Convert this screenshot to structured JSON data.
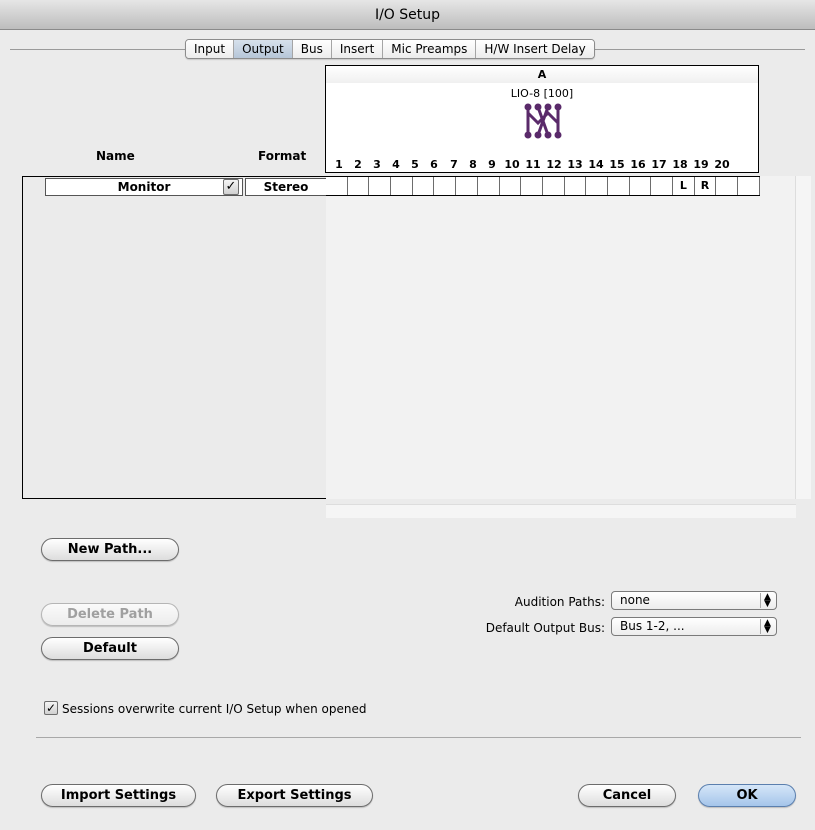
{
  "window": {
    "title": "I/O Setup"
  },
  "tabs": [
    "Input",
    "Output",
    "Bus",
    "Insert",
    "Mic Preamps",
    "H/W Insert Delay"
  ],
  "active_tab": "Output",
  "matrix": {
    "section": "A",
    "device": "LIO-8 [100]",
    "device_icon": "lio-device-icon",
    "channels": [
      "1",
      "2",
      "3",
      "4",
      "5",
      "6",
      "7",
      "8",
      "9",
      "10",
      "11",
      "12",
      "13",
      "14",
      "15",
      "16",
      "17",
      "18",
      "19",
      "20"
    ]
  },
  "columns": {
    "name": "Name",
    "format": "Format"
  },
  "paths": [
    {
      "name": "Monitor",
      "active": true,
      "check_glyph": "✓",
      "format": "Stereo",
      "assignments": [
        "",
        "",
        "",
        "",
        "",
        "",
        "",
        "",
        "",
        "",
        "",
        "",
        "",
        "",
        "",
        "",
        "L",
        "R",
        "",
        ""
      ]
    }
  ],
  "buttons": {
    "new_path": "New Path...",
    "delete_path": "Delete Path",
    "default": "Default",
    "import_settings": "Import Settings",
    "export_settings": "Export Settings",
    "cancel": "Cancel",
    "ok": "OK"
  },
  "audition_paths": {
    "label": "Audition Paths:",
    "value": "none"
  },
  "default_output_bus": {
    "label": "Default Output Bus:",
    "value": "Bus 1-2, ..."
  },
  "sessions_overwrite": {
    "label": "Sessions overwrite current I/O Setup when opened",
    "checked": true,
    "check_glyph": "✓"
  },
  "colors": {
    "accent": "#a5c5ea",
    "device_icon": "#5a2a6a"
  }
}
